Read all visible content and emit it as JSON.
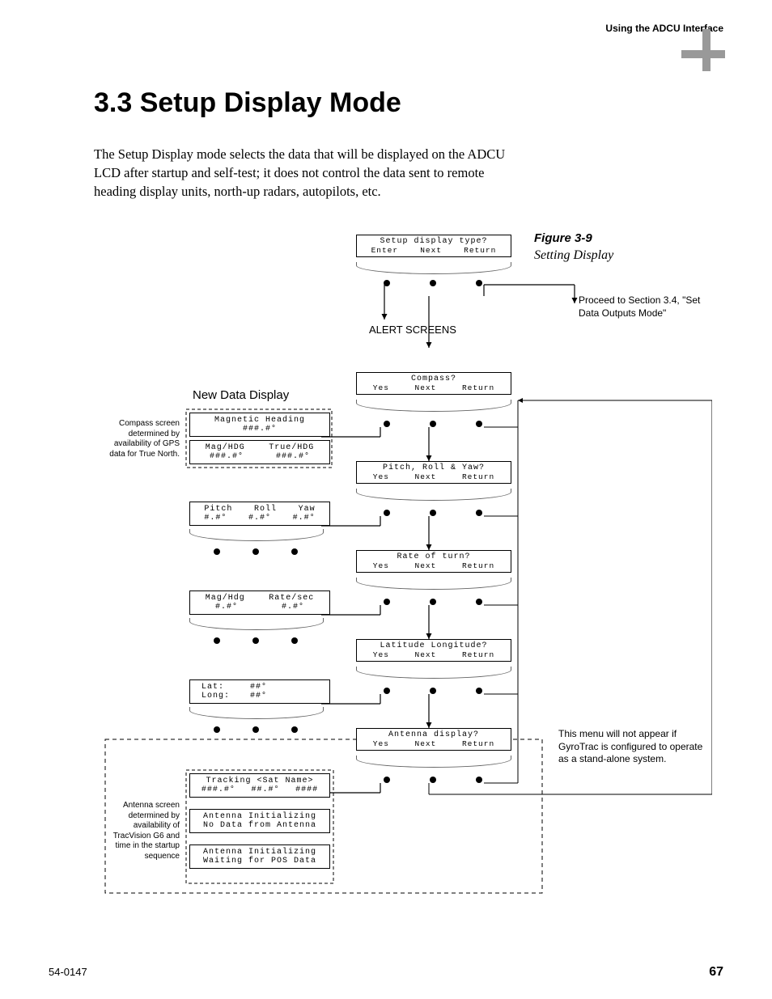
{
  "header": {
    "running": "Using the ADCU Interface"
  },
  "title": "3.3   Setup Display Mode",
  "intro": "The Setup Display mode selects the data that will be displayed on the ADCU LCD after startup and self-test; it does not control the data sent to remote heading display units, north-up radars, autopilots, etc.",
  "figure": {
    "label": "Figure 3-9",
    "caption": "Setting Display"
  },
  "footer": {
    "left": "54-0147",
    "page": "67"
  },
  "labels": {
    "alert_screens": "ALERT SCREENS",
    "new_data_display": "New Data Display",
    "proceed": "Proceed to Section 3.4, \"Set Data Outputs Mode\"",
    "compass_note": "Compass screen determined by availability of GPS data for True North.",
    "antenna_note": "Antenna screen determined by availability of TracVision G6 and time in the startup sequence",
    "gyrotrac_note": "This menu will not appear if GyroTrac is configured to operate as a stand-alone system."
  },
  "screens": {
    "setup": {
      "q": "Setup display type?",
      "b": [
        "Enter",
        "Next",
        "Return"
      ]
    },
    "compass": {
      "q": "Compass?",
      "b": [
        "Yes",
        "Next",
        "Return"
      ]
    },
    "pry": {
      "q": "Pitch, Roll & Yaw?",
      "b": [
        "Yes",
        "Next",
        "Return"
      ]
    },
    "rot": {
      "q": "Rate of turn?",
      "b": [
        "Yes",
        "Next",
        "Return"
      ]
    },
    "latlon": {
      "q": "Latitude Longitude?",
      "b": [
        "Yes",
        "Next",
        "Return"
      ]
    },
    "antenna": {
      "q": "Antenna display?",
      "b": [
        "Yes",
        "Next",
        "Return"
      ]
    }
  },
  "data_boxes": {
    "maghd": {
      "l1": "Magnetic Heading",
      "l2": "###.#°"
    },
    "maghdg2": {
      "h": [
        "Mag/HDG",
        "True/HDG"
      ],
      "v": [
        "###.#°",
        "###.#°"
      ]
    },
    "pry_box": {
      "h": [
        "Pitch",
        "Roll",
        "Yaw"
      ],
      "v": [
        "#.#°",
        "#.#°",
        "#.#°"
      ]
    },
    "rot_box": {
      "h": [
        "Mag/Hdg",
        "Rate/sec"
      ],
      "v": [
        "#.#°",
        "#.#°"
      ]
    },
    "latlon_box": {
      "lat_l": "Lat:",
      "lat_v": "##°",
      "lon_l": "Long:",
      "lon_v": "##°"
    },
    "track": {
      "l1": "Tracking <Sat Name>",
      "l2h": [
        "###.#°",
        "##.#°",
        "####"
      ]
    },
    "init1": {
      "l1": "Antenna Initializing",
      "l2": "No Data from Antenna"
    },
    "init2": {
      "l1": "Antenna Initializing",
      "l2": "Waiting for POS Data"
    }
  }
}
